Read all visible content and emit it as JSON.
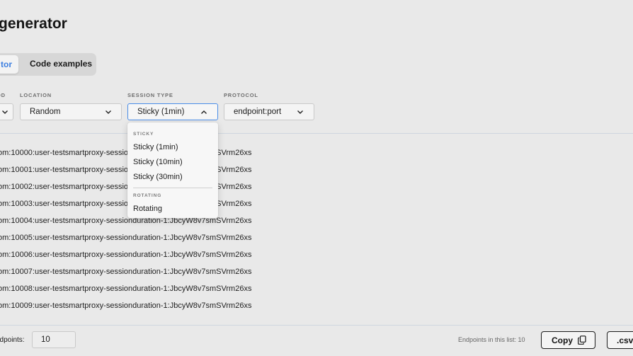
{
  "header": {
    "title": "generator"
  },
  "tabs": [
    {
      "label": "tor",
      "active": true
    },
    {
      "label": "Code examples",
      "active": false
    }
  ],
  "filters": [
    {
      "label": "OD",
      "value": ""
    },
    {
      "label": "LOCATION",
      "value": "Random"
    },
    {
      "label": "SESSION TYPE",
      "value": "Sticky (1min)",
      "open": true
    },
    {
      "label": "PROTOCOL",
      "value": "endpoint:port"
    }
  ],
  "session_dropdown": {
    "groups": [
      {
        "label": "STICKY",
        "options": [
          "Sticky (1min)",
          "Sticky (10min)",
          "Sticky (30min)"
        ]
      },
      {
        "label": "ROTATING",
        "options": [
          "Rotating"
        ]
      }
    ]
  },
  "endpoints": [
    "om:10000:user-testsmartproxy-sessionduration-1:JbcyW8v7smSVrm26xs",
    "om:10001:user-testsmartproxy-sessionduration-1:JbcyW8v7smSVrm26xs",
    "om:10002:user-testsmartproxy-sessionduration-1:JbcyW8v7smSVrm26xs",
    "om:10003:user-testsmartproxy-sessionduration-1:JbcyW8v7smSVrm26xs",
    "om:10004:user-testsmartproxy-sessionduration-1:JbcyW8v7smSVrm26xs",
    "om:10005:user-testsmartproxy-sessionduration-1:JbcyW8v7smSVrm26xs",
    "om:10006:user-testsmartproxy-sessionduration-1:JbcyW8v7smSVrm26xs",
    "om:10007:user-testsmartproxy-sessionduration-1:JbcyW8v7smSVrm26xs",
    "om:10008:user-testsmartproxy-sessionduration-1:JbcyW8v7smSVrm26xs",
    "om:10009:user-testsmartproxy-sessionduration-1:JbcyW8v7smSVrm26xs"
  ],
  "footer": {
    "count_label": "ndpoints:",
    "count_value": "10",
    "list_count": "Endpoints in this list: 10",
    "copy_label": "Copy",
    "csv_label": ".csv"
  },
  "icons": {
    "chevron": "chevron-down-icon",
    "chevron_open": "chevron-up-icon",
    "copy": "copy-icon"
  },
  "colors": {
    "accent": "#3d7fe0",
    "focus": "#4a8de8"
  }
}
